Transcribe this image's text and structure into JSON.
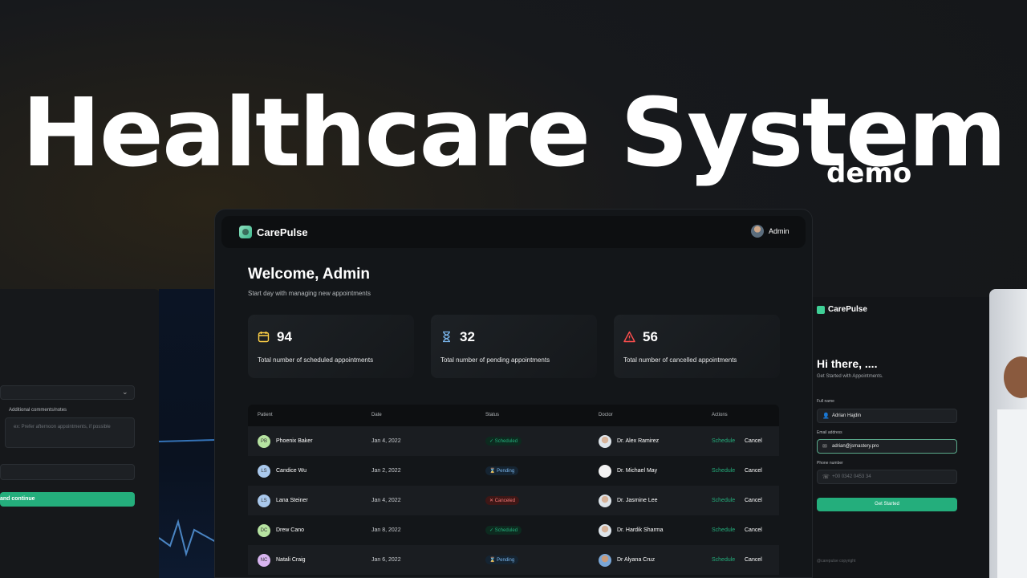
{
  "hero": {
    "title": "Healthcare System",
    "subtitle": "demo"
  },
  "left_form": {
    "notes_label": "Additional comments/notes",
    "notes_placeholder": "ex: Prefer afternoon appointments, if possible",
    "submit_label": "and continue"
  },
  "right_form": {
    "brand": "CarePulse",
    "greeting": "Hi there, ....",
    "subtitle": "Get Started with Appointments.",
    "fullname_label": "Full name",
    "fullname_value": "Adrian Hajdin",
    "email_label": "Email address",
    "email_value": "adrian@jsmastery.pro",
    "phone_label": "Phone number",
    "phone_value": "+00 0342 0453 34",
    "button_label": "Get Started",
    "copyright": "@carepulse copyright"
  },
  "dashboard": {
    "brand": "CarePulse",
    "user": "Admin",
    "welcome": "Welcome, Admin",
    "welcome_sub": "Start day with managing new appointments",
    "stats": [
      {
        "value": "94",
        "label": "Total number of  scheduled appointments",
        "color": "#ffd147",
        "icon": "calendar-icon"
      },
      {
        "value": "32",
        "label": "Total number of pending appointments",
        "color": "#79b5ec",
        "icon": "hourglass-icon"
      },
      {
        "value": "56",
        "label": "Total number of cancelled  appointments",
        "color": "#ff4f4e",
        "icon": "warning-icon"
      }
    ],
    "table": {
      "headers": [
        "Patient",
        "Date",
        "Status",
        "Doctor",
        "Actions"
      ],
      "rows": [
        {
          "initials": "PB",
          "initials_bg": "#b6e3a1",
          "patient": "Phoenix Baker",
          "date": "Jan 4, 2022",
          "status": "Scheduled",
          "status_icon": "✓",
          "doctor": "Dr. Alex Ramirez",
          "schedule": "Schedule",
          "cancel": "Cancel"
        },
        {
          "initials": "LS",
          "initials_bg": "#a9c8ec",
          "patient": "Candice Wu",
          "date": "Jan 2, 2022",
          "status": "Pending",
          "status_icon": "⌛",
          "doctor": "Dr. Michael May",
          "schedule": "Schedule",
          "cancel": "Cancel"
        },
        {
          "initials": "LS",
          "initials_bg": "#a9c8ec",
          "patient": "Lana Steiner",
          "date": "Jan 4, 2022",
          "status": "Canceled",
          "status_icon": "✕",
          "doctor": "Dr. Jasmine Lee",
          "schedule": "Schedule",
          "cancel": "Cancel"
        },
        {
          "initials": "DC",
          "initials_bg": "#b6e3a1",
          "patient": "Drew Cano",
          "date": "Jan 8, 2022",
          "status": "Scheduled",
          "status_icon": "✓",
          "doctor": "Dr. Hardik Sharma",
          "schedule": "Schedule",
          "cancel": "Cancel"
        },
        {
          "initials": "NC",
          "initials_bg": "#d7b4ef",
          "patient": "Natali Craig",
          "date": "Jan 6, 2022",
          "status": "Pending",
          "status_icon": "⌛",
          "doctor": "Dr Alyana Cruz",
          "schedule": "Schedule",
          "cancel": "Cancel"
        }
      ]
    }
  }
}
